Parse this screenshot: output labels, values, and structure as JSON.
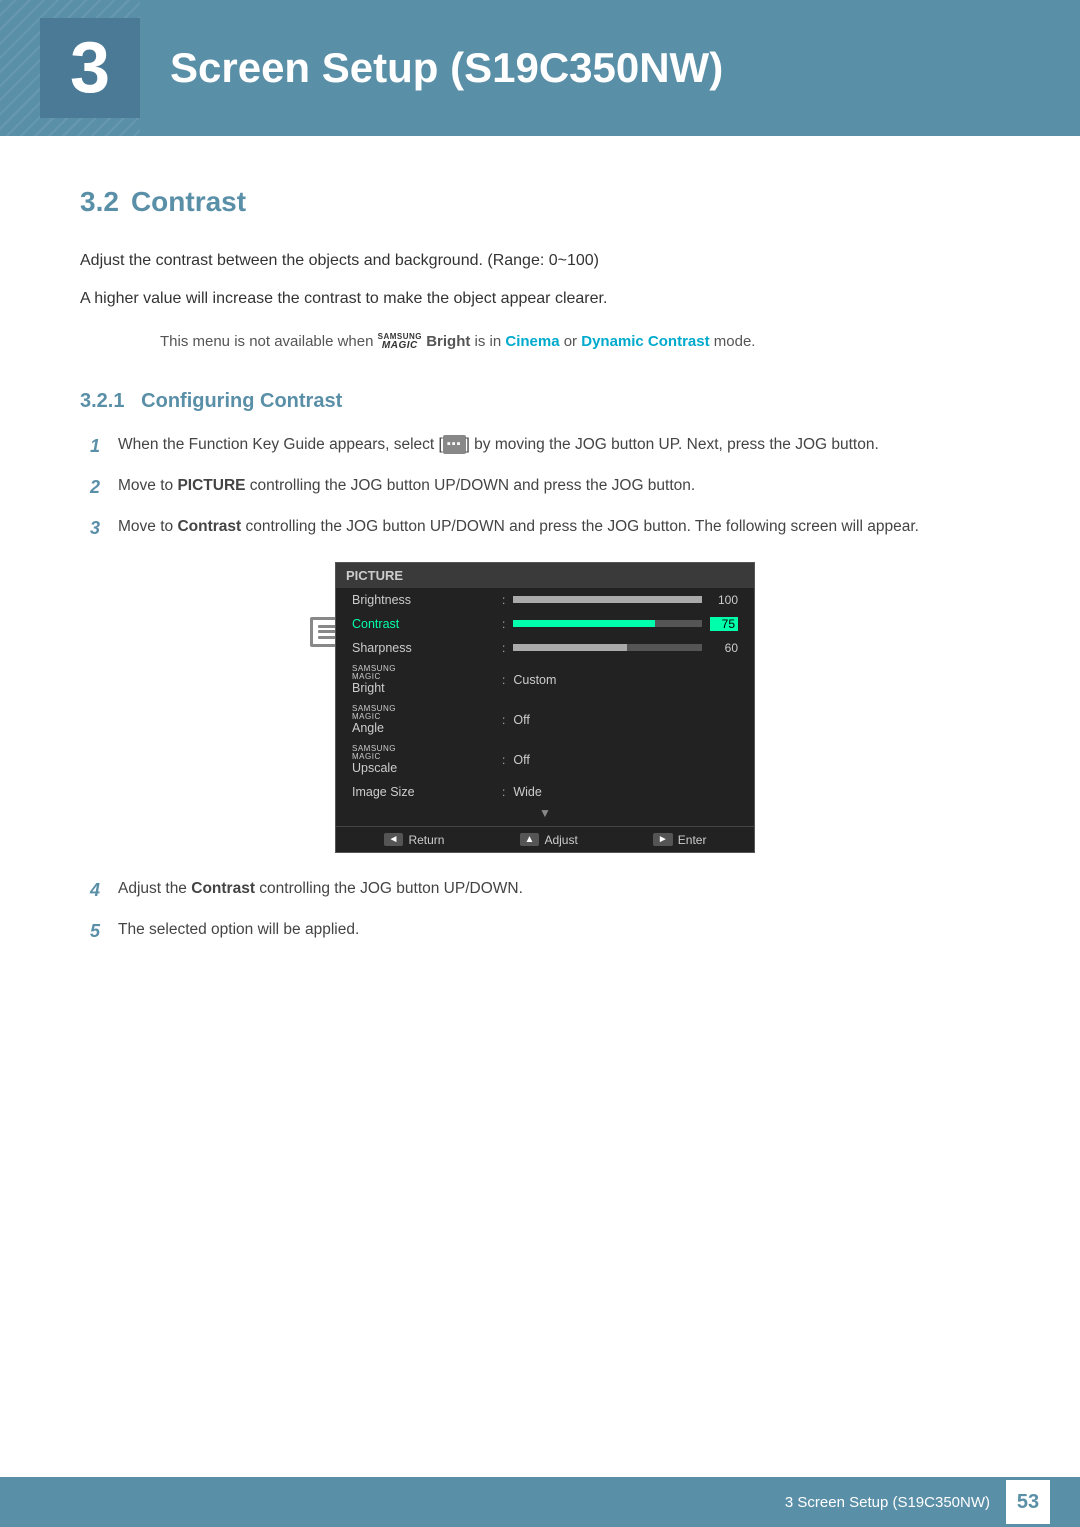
{
  "header": {
    "chapter_number": "3",
    "title": "Screen Setup (S19C350NW)",
    "bg_color": "#5a8fa8"
  },
  "section": {
    "number": "3.2",
    "title": "Contrast",
    "description_1": "Adjust the contrast between the objects and background. (Range: 0~100)",
    "description_2": "A higher value will increase the contrast to make the object appear clearer.",
    "note": "This menu is not available when",
    "note_magic": "SAMSUNG MAGIC",
    "note_bright": "Bright",
    "note_middle": "is in",
    "note_cinema": "Cinema",
    "note_or": "or",
    "note_dynamic": "Dynamic Contrast",
    "note_end": "mode."
  },
  "subsection": {
    "number": "3.2.1",
    "title": "Configuring Contrast"
  },
  "steps": [
    {
      "number": "1",
      "text_before": "When the Function Key Guide appears, select [",
      "jog_symbol": "▪▪▪",
      "text_after": "] by moving the JOG button UP. Next, press the JOG button."
    },
    {
      "number": "2",
      "text_before": "Move to ",
      "bold": "PICTURE",
      "text_after": " controlling the JOG button UP/DOWN and press the JOG button."
    },
    {
      "number": "3",
      "text_before": "Move to ",
      "bold": "Contrast",
      "text_after": " controlling the JOG button UP/DOWN and press the JOG button. The following screen will appear."
    },
    {
      "number": "4",
      "text_before": "Adjust the ",
      "bold": "Contrast",
      "text_after": " controlling the JOG button UP/DOWN."
    },
    {
      "number": "5",
      "text": "The selected option will be applied."
    }
  ],
  "osd": {
    "title": "PICTURE",
    "rows": [
      {
        "label": "Brightness",
        "type": "bar",
        "fill": 100,
        "value": "100",
        "selected": false,
        "fill_color": "#aaa"
      },
      {
        "label": "Contrast",
        "type": "bar",
        "fill": 75,
        "value": "75",
        "selected": true,
        "fill_color": "#00ffaa"
      },
      {
        "label": "Sharpness",
        "type": "bar",
        "fill": 60,
        "value": "60",
        "selected": false,
        "fill_color": "#aaa"
      },
      {
        "label": "SAMSUNG MAGIC Bright",
        "type": "value",
        "value": "Custom",
        "selected": false,
        "magic": true
      },
      {
        "label": "SAMSUNG MAGIC Angle",
        "type": "value",
        "value": "Off",
        "selected": false,
        "magic": true
      },
      {
        "label": "SAMSUNG MAGIC Upscale",
        "type": "value",
        "value": "Off",
        "selected": false,
        "magic": true
      },
      {
        "label": "Image Size",
        "type": "value",
        "value": "Wide",
        "selected": false,
        "magic": false
      }
    ],
    "more_indicator": "▼",
    "footer": [
      {
        "btn": "◄",
        "label": "Return"
      },
      {
        "btn": "▲",
        "label": "Adjust"
      },
      {
        "btn": "►",
        "label": "Enter"
      }
    ]
  },
  "footer": {
    "text": "3 Screen Setup (S19C350NW)",
    "page": "53"
  }
}
